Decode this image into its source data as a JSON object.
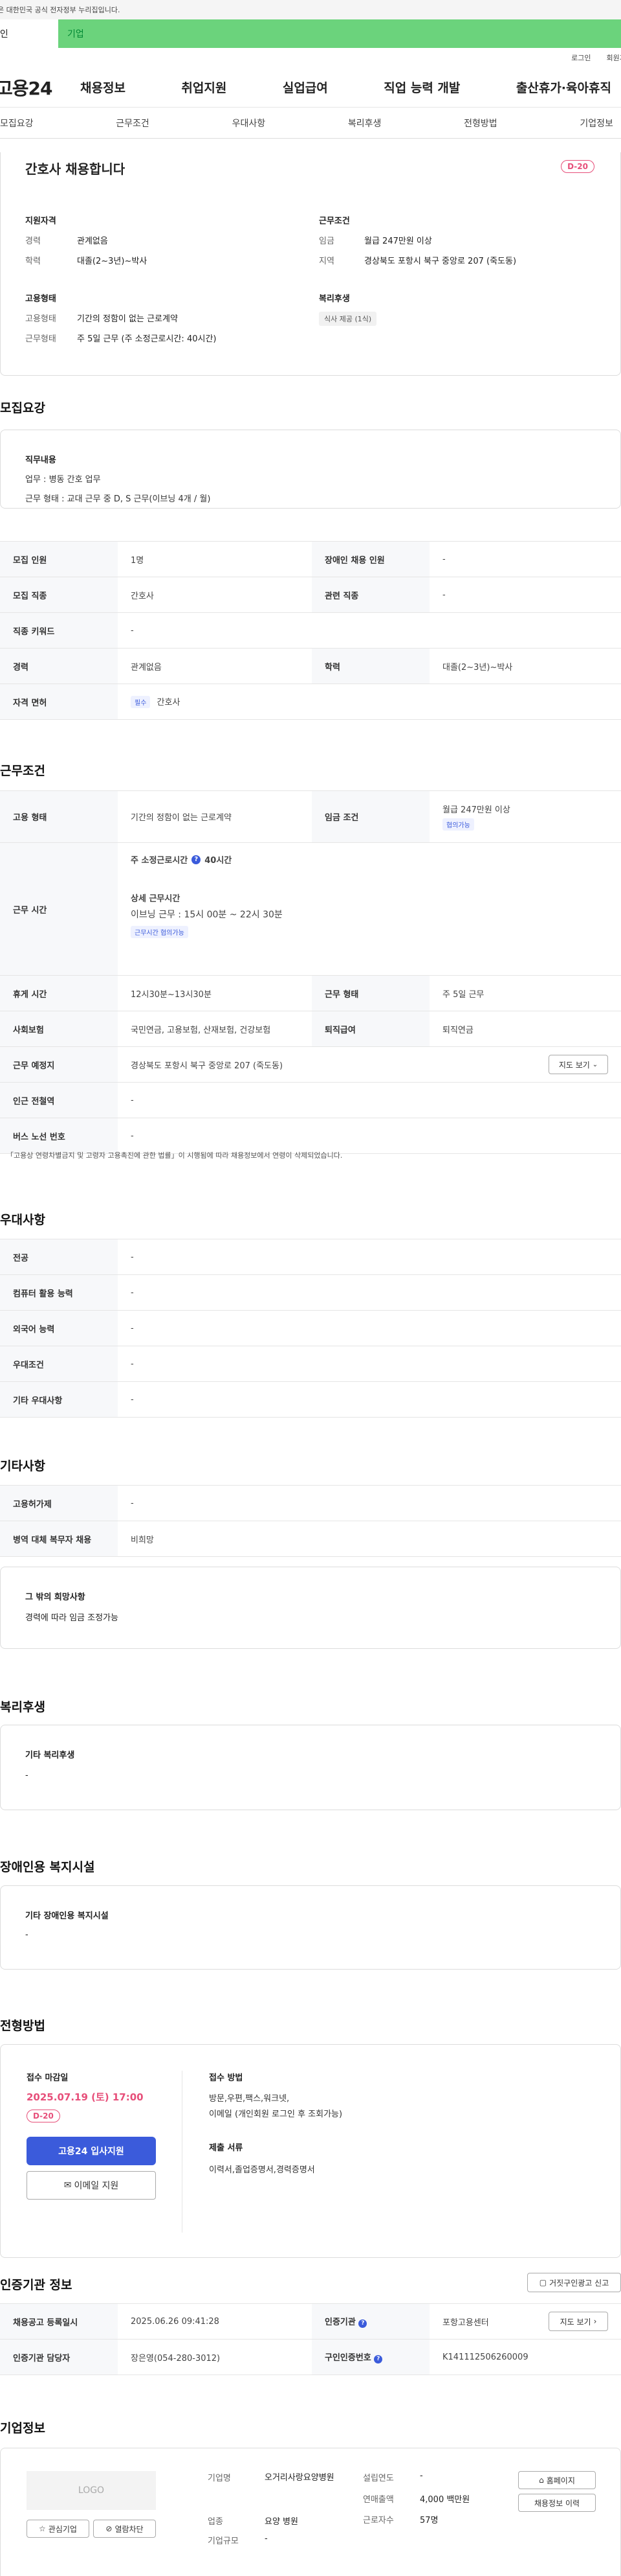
{
  "header": {
    "gov_notice": "이 누리집은 대한민국 공식 전자정부 누리집입니다.",
    "type_individual": "개인",
    "type_business": "기업",
    "login": "로그인",
    "signup": "회원가입",
    "logo": "고용24",
    "nav": [
      "채용정보",
      "취업지원",
      "실업급여",
      "직업 능력 개발",
      "출산휴가·육아휴직"
    ]
  },
  "tabs": [
    "모집요강",
    "근무조건",
    "우대사항",
    "복리후생",
    "전형방법",
    "기업정보"
  ],
  "summary": {
    "title": "간호사 채용합니다",
    "dday": "D-20",
    "qual_title": "지원자격",
    "career_k": "경력",
    "career_v": "관계없음",
    "edu_k": "학력",
    "edu_v": "대졸(2~3년)~박사",
    "cond_title": "근무조건",
    "wage_k": "임금",
    "wage_v": "월급 247만원 이상",
    "loc_k": "지역",
    "loc_v": "경상북도 포항시 북구 중앙로 207 (죽도동)",
    "emp_title": "고용형태",
    "emptype_k": "고용형태",
    "emptype_v": "기간의 정함이 없는 근로계약",
    "worktype_k": "근무형태",
    "worktype_v": "주 5일 근무 (주 소정근로시간: 40시간)",
    "welfare_title": "복리후생",
    "welfare_tag": "식사 제공 (1식)"
  },
  "recruit": {
    "title": "모집요강",
    "duty_title": "직무내용",
    "duty_line1": "업무 : 병동 간호 업무",
    "duty_line2": "근무 형태 : 교대 근무 중 D, S 근무(이브닝 4개 / 월)",
    "rows": [
      [
        "모집 인원",
        "1명",
        "장애인 채용 인원",
        "-"
      ],
      [
        "모집 직종",
        "간호사",
        "관련 직종",
        "-"
      ],
      [
        "직종 키워드",
        "-",
        "",
        ""
      ],
      [
        "경력",
        "관계없음",
        "학력",
        "대졸(2~3년)~박사"
      ]
    ],
    "license_k": "자격 면허",
    "license_tag": "필수",
    "license_v": "간호사"
  },
  "work": {
    "title": "근무조건",
    "emp_k": "고용 형태",
    "emp_v": "기간의 정함이 없는 근로계약",
    "wage_k": "임금 조건",
    "wage_v": "월급 247만원 이상",
    "wage_tag": "협의가능",
    "hours_k": "근무 시간",
    "hours_main": "주 소정근로시간",
    "hours_val": "40시간",
    "detail_title": "상세 근무시간",
    "detail_v": "이브닝 근무 : 15시 00분 ~  22시 30분",
    "detail_tag": "근무시간 협의가능",
    "break_k": "휴게 시간",
    "break_v": "12시30분~13시30분",
    "type_k": "근무 형태",
    "type_v": "주 5일 근무",
    "ins_k": "사회보험",
    "ins_v": "국민연금, 고용보험, 산재보험, 건강보험",
    "sev_k": "퇴직급여",
    "sev_v": "퇴직연금",
    "place_k": "근무 예정지",
    "place_v": "경상북도 포항시 북구 중앙로 207 (죽도동)",
    "map_btn": "지도 보기",
    "subway_k": "인근 전철역",
    "subway_v": "-",
    "bus_k": "버스 노선 번호",
    "bus_v": "-",
    "note": "「고용상 연령차별금지 및 고령자 고용촉진에 관한 법률」이 시행됨에 따라 채용정보에서 연령이 삭제되었습니다."
  },
  "pref": {
    "title": "우대사항",
    "rows": [
      [
        "전공",
        "-"
      ],
      [
        "컴퓨터 활용 능력",
        "-"
      ],
      [
        "외국어 능력",
        "-"
      ],
      [
        "우대조건",
        "-"
      ],
      [
        "기타 우대사항",
        "-"
      ]
    ]
  },
  "etc": {
    "title": "기타사항",
    "rows": [
      [
        "고용허가제",
        "-"
      ],
      [
        "병역 대체 복무자 채용",
        "비희망"
      ]
    ],
    "wish_title": "그 밖의 희망사항",
    "wish_v": "경력에 따라 임금 조정가능"
  },
  "welfare": {
    "title": "복리후생",
    "sub": "기타 복리후생",
    "v": "-"
  },
  "disab": {
    "title": "장애인용 복지시설",
    "sub": "기타 장애인용 복지시설",
    "v": "-"
  },
  "screen": {
    "title": "전형방법",
    "deadline_k": "접수 마감일",
    "deadline_v": "2025.07.19 (토) 17:00",
    "dday": "D-20",
    "apply_btn": "고용24 입사지원",
    "email_btn": "이메일 지원",
    "method_k": "접수 방법",
    "method_v1": "방문,우편,팩스,워크넷,",
    "method_v2": "이메일 (개인회원 로그인 후 조회가능)",
    "doc_k": "제출 서류",
    "doc_v": "이력서,졸업증명서,경력증명서"
  },
  "cert": {
    "title": "인증기관 정보",
    "report_btn": "거짓구인광고 신고",
    "reg_k": "채용공고 등록일시",
    "reg_v": "2025.06.26 09:41:28",
    "org_k": "인증기관",
    "org_v": "포항고용센터",
    "map_btn": "지도 보기",
    "mgr_k": "인증기관 담당자",
    "mgr_v": "장은영(054-280-3012)",
    "no_k": "구인인증번호",
    "no_v": "K141112506260009"
  },
  "company": {
    "title": "기업정보",
    "logo": "LOGO",
    "fav_btn": "관심기업",
    "block_btn": "열람차단",
    "name_k": "기업명",
    "name_v": "오거리사랑요양병원",
    "biz_k": "업종",
    "biz_v": "요양 병원",
    "size_k": "기업규모",
    "size_v": "-",
    "year_k": "설립연도",
    "year_v": "-",
    "sales_k": "연매출액",
    "sales_v": "4,000 백만원",
    "emp_k": "근로자수",
    "emp_v": "57명",
    "home_btn": "홈페이지",
    "hist_btn": "채용정보 이력"
  }
}
